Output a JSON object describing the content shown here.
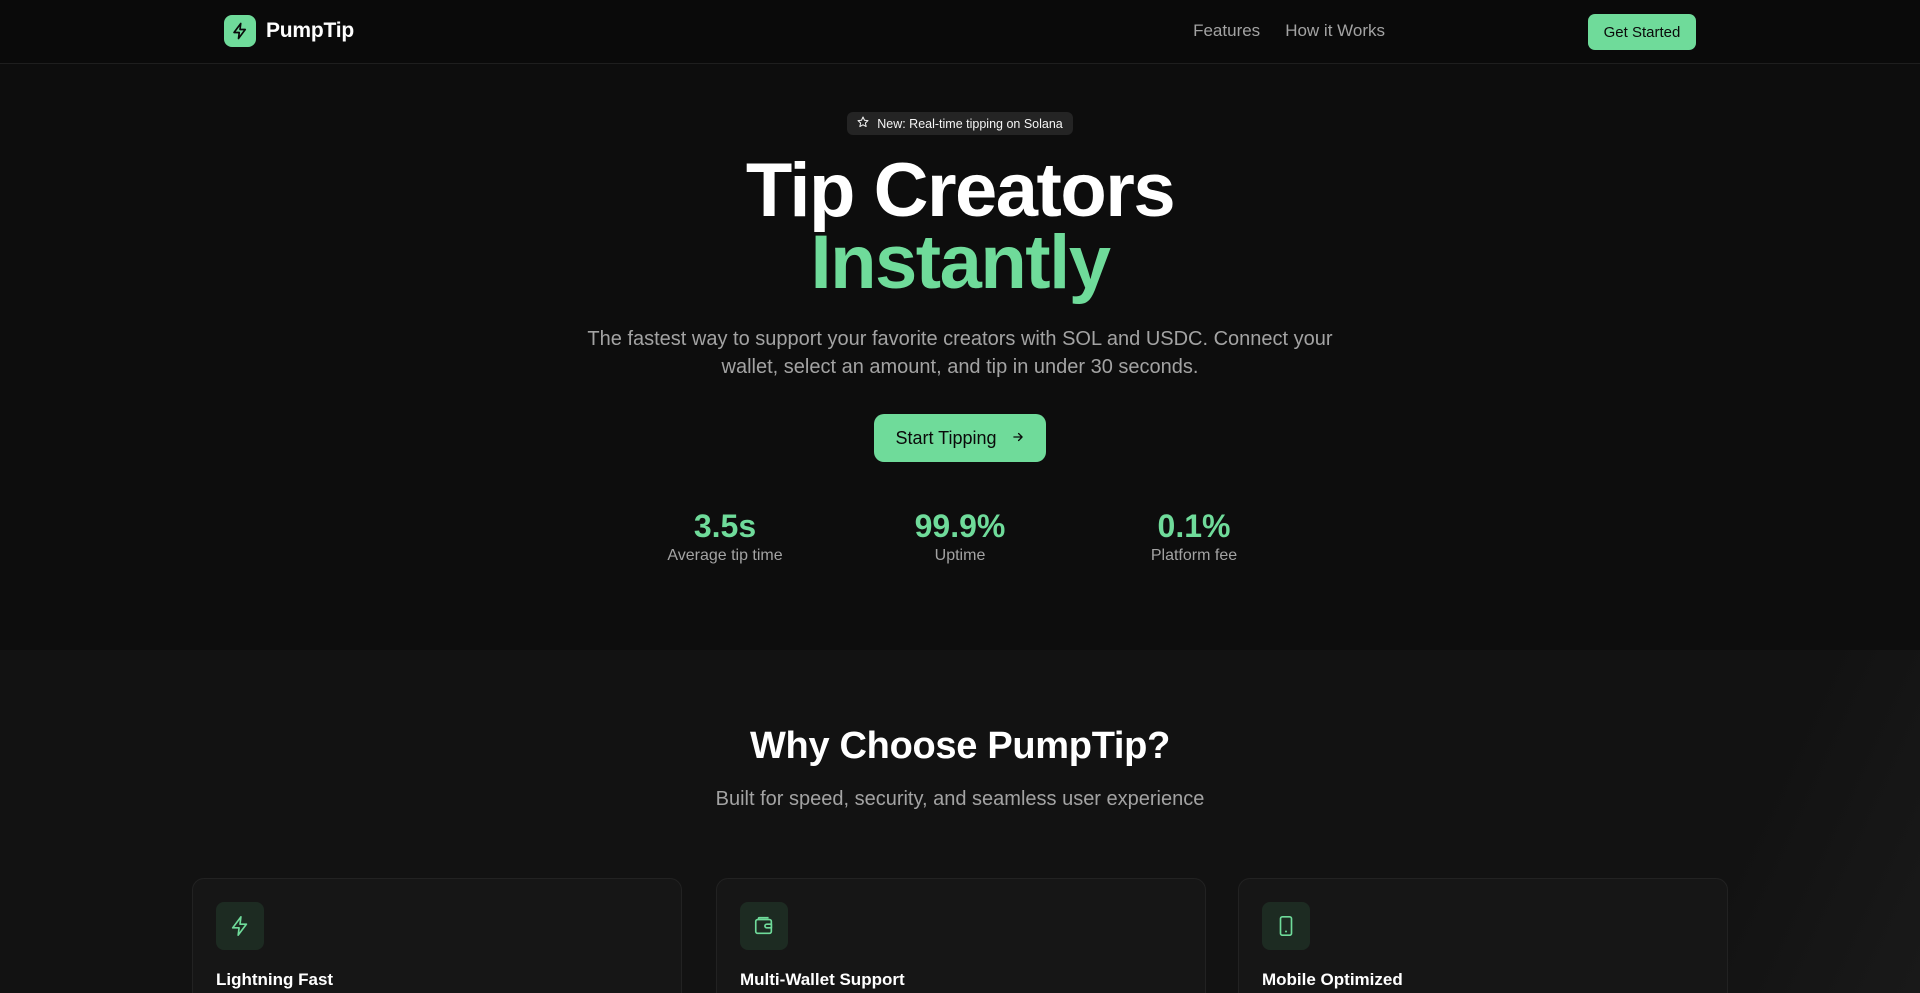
{
  "colors": {
    "accent": "#6fdb9a",
    "background": "#0d0d0d",
    "muted": "#a3a3a3"
  },
  "nav": {
    "brand": "PumpTip",
    "brand_icon": "bolt-icon",
    "links": [
      "Features",
      "How it Works"
    ],
    "cta": "Get Started"
  },
  "hero": {
    "badge_icon": "star-icon",
    "badge": "New: Real-time tipping on Solana",
    "title_line1": "Tip Creators",
    "title_line2": "Instantly",
    "subtitle": "The fastest way to support your favorite creators with SOL and USDC. Connect your wallet, select an amount, and tip in under 30 seconds.",
    "cta": "Start Tipping",
    "cta_icon": "arrow-right-icon",
    "stats": [
      {
        "value": "3.5s",
        "label": "Average tip time"
      },
      {
        "value": "99.9%",
        "label": "Uptime"
      },
      {
        "value": "0.1%",
        "label": "Platform fee"
      }
    ]
  },
  "features": {
    "title": "Why Choose PumpTip?",
    "subtitle": "Built for speed, security, and seamless user experience",
    "cards": [
      {
        "icon": "bolt-icon",
        "title": "Lightning Fast"
      },
      {
        "icon": "wallet-icon",
        "title": "Multi-Wallet Support"
      },
      {
        "icon": "smartphone-icon",
        "title": "Mobile Optimized"
      }
    ]
  }
}
